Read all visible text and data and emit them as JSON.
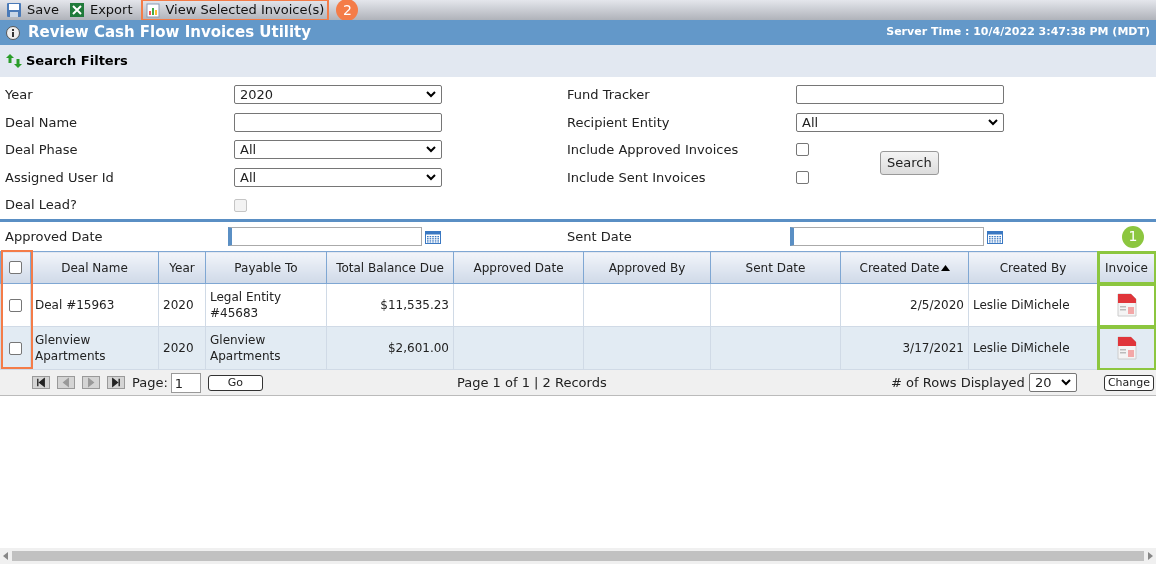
{
  "toolbar": [
    {
      "kind": "save",
      "label": "Save"
    },
    {
      "kind": "export",
      "label": "Export"
    },
    {
      "kind": "view",
      "label": "View Selected Invoice(s)"
    }
  ],
  "title": "Review Cash Flow Invoices Utility",
  "server_time": "Server Time : 10/4/2022 3:47:38 PM (MDT)",
  "filters": {
    "heading": "Search Filters",
    "rows": [
      [
        {
          "kind": "select",
          "label": "Year",
          "value": "2020"
        },
        {
          "kind": "text",
          "label": "Fund Tracker"
        }
      ],
      [
        {
          "kind": "text",
          "label": "Deal Name"
        },
        {
          "kind": "select",
          "label": "Recipient Entity",
          "value": "All"
        }
      ],
      [
        {
          "kind": "select",
          "label": "Deal Phase",
          "value": "All"
        },
        {
          "kind": "checkbox",
          "label": "Include Approved Invoices",
          "checked": false,
          "disabled": false
        }
      ],
      [
        {
          "kind": "select",
          "label": "Assigned User Id",
          "value": "All"
        },
        {
          "kind": "checkbox",
          "label": "Include Sent Invoices",
          "checked": false,
          "disabled": false
        }
      ],
      [
        {
          "kind": "checkbox",
          "label": "Deal Lead?",
          "checked": false,
          "disabled": true
        }
      ]
    ],
    "search_button": "Search",
    "date_filters": [
      {
        "label": "Approved Date"
      },
      {
        "label": "Sent Date"
      }
    ]
  },
  "table": {
    "select_all": {
      "checked": false
    },
    "columns": [
      {
        "label": "Deal Name",
        "sorted": false
      },
      {
        "label": "Year",
        "sorted": false
      },
      {
        "label": "Payable To",
        "sorted": false
      },
      {
        "label": "Total Balance Due",
        "sorted": false
      },
      {
        "label": "Approved Date",
        "sorted": false
      },
      {
        "label": "Approved By",
        "sorted": false
      },
      {
        "label": "Sent Date",
        "sorted": false
      },
      {
        "label": "Created Date",
        "sorted": true
      },
      {
        "label": "Created By",
        "sorted": false
      },
      {
        "label": "Invoice",
        "sorted": false
      }
    ],
    "rows": [
      {
        "selected": false,
        "cells": [
          "Deal #15963",
          "2020",
          "Legal Entity #45683",
          "$11,535.23",
          "",
          "",
          "",
          "2/5/2020",
          "Leslie DiMichele"
        ]
      },
      {
        "selected": false,
        "cells": [
          "Glenview Apartments",
          "2020",
          "Glenview Apartments",
          "$2,601.00",
          "",
          "",
          "",
          "3/17/2021",
          "Leslie DiMichele"
        ]
      }
    ]
  },
  "pager": {
    "page_label": "Page:",
    "page": "1",
    "go": "Go",
    "summary": "Page 1 of 1 | 2 Records",
    "rows_label": "# of Rows Displayed",
    "rows_value": "20",
    "change": "Change"
  },
  "annotations": [
    {
      "number": "1",
      "color": "#8cc63f"
    },
    {
      "number": "2",
      "color": "#f47c48"
    }
  ]
}
